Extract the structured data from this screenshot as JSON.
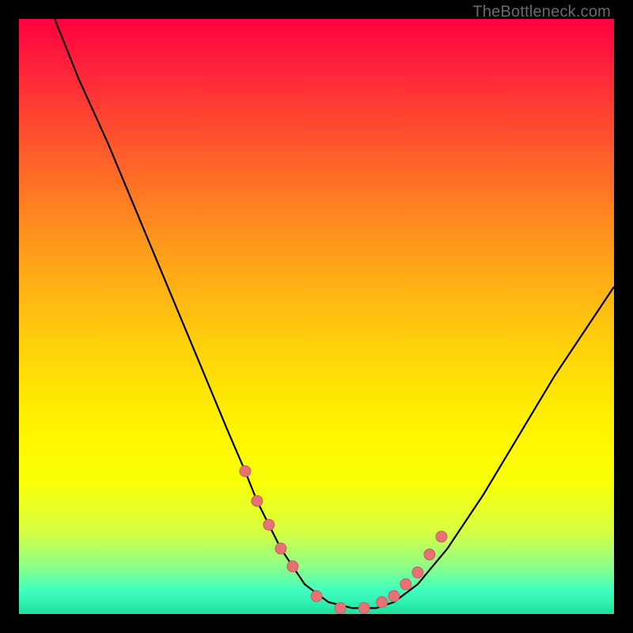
{
  "watermark": "TheBottleneck.com",
  "colors": {
    "background": "#000000",
    "curve": "#000000",
    "marker_fill": "#e57373",
    "marker_stroke": "#c95f5f"
  },
  "chart_data": {
    "type": "line",
    "title": "",
    "xlabel": "",
    "ylabel": "",
    "xlim": [
      0,
      100
    ],
    "ylim": [
      0,
      100
    ],
    "note": "Axes are unlabeled; values are relative percentages read from the plot area. y=0 is the bottom edge (green), y=100 is the top edge (red).",
    "series": [
      {
        "name": "bottleneck-curve",
        "x": [
          6,
          10,
          15,
          20,
          25,
          30,
          35,
          38,
          40,
          44,
          48,
          52,
          56,
          60,
          63,
          67,
          72,
          78,
          84,
          90,
          96,
          100
        ],
        "y": [
          100,
          90,
          79,
          67,
          55,
          43,
          31,
          24,
          19,
          11,
          5,
          2,
          1,
          1,
          2,
          5,
          11,
          20,
          30,
          40,
          49,
          55
        ]
      }
    ],
    "markers": {
      "name": "highlight-dots",
      "x": [
        38,
        40,
        42,
        44,
        46,
        50,
        54,
        58,
        61,
        63,
        65,
        67,
        69,
        71
      ],
      "y": [
        24,
        19,
        15,
        11,
        8,
        3,
        1,
        1,
        2,
        3,
        5,
        7,
        10,
        13
      ]
    }
  }
}
